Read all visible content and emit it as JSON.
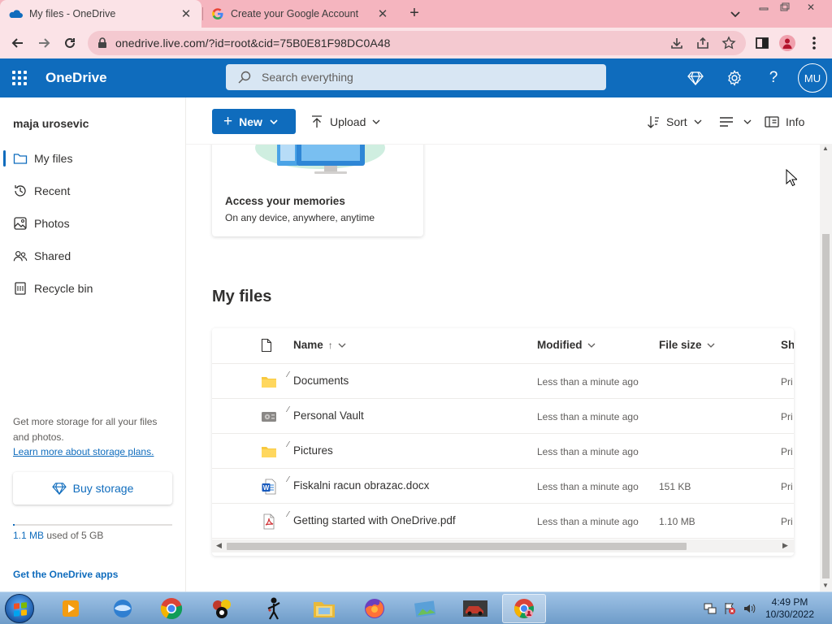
{
  "browser": {
    "tabs": [
      {
        "title": "My files - OneDrive",
        "icon": "onedrive-cloud-icon",
        "active": true
      },
      {
        "title": "Create your Google Account",
        "icon": "google-g-icon",
        "active": false
      }
    ],
    "url": "onedrive.live.com/?id=root&cid=75B0E81F98DC0A48"
  },
  "header": {
    "brand": "OneDrive",
    "search_placeholder": "Search everything",
    "avatar_initials": "MU"
  },
  "nav": {
    "user_name": "maja urosevic",
    "items": [
      {
        "label": "My files",
        "icon": "folder-icon",
        "selected": true
      },
      {
        "label": "Recent",
        "icon": "history-icon",
        "selected": false
      },
      {
        "label": "Photos",
        "icon": "photos-icon",
        "selected": false
      },
      {
        "label": "Shared",
        "icon": "people-icon",
        "selected": false
      },
      {
        "label": "Recycle bin",
        "icon": "recycle-bin-icon",
        "selected": false
      }
    ],
    "storage_text": "Get more storage for all your files and photos.",
    "storage_link": "Learn more about storage plans.",
    "buy_storage": "Buy storage",
    "quota_used": "1.1 MB",
    "quota_rest": " used of 5 GB",
    "quota_fraction": 0.0002,
    "get_apps": "Get the OneDrive apps"
  },
  "commands": {
    "new": "New",
    "upload": "Upload",
    "sort": "Sort",
    "info": "Info"
  },
  "memories": {
    "title": "Access your memories",
    "subtitle": "On any device, anywhere, anytime"
  },
  "files": {
    "section_title": "My files",
    "columns": {
      "name": "Name",
      "name_sort": "↑",
      "modified": "Modified",
      "size": "File size",
      "sharing": "Sh"
    },
    "rows": [
      {
        "name": "Documents",
        "type": "folder",
        "modified": "Less than a minute ago",
        "size": "",
        "sharing": "Pri"
      },
      {
        "name": "Personal Vault",
        "type": "vault",
        "modified": "Less than a minute ago",
        "size": "",
        "sharing": "Pri"
      },
      {
        "name": "Pictures",
        "type": "folder",
        "modified": "Less than a minute ago",
        "size": "",
        "sharing": "Pri"
      },
      {
        "name": "Fiskalni racun obrazac.docx",
        "type": "word",
        "modified": "Less than a minute ago",
        "size": "151 KB",
        "sharing": "Pri"
      },
      {
        "name": "Getting started with OneDrive.pdf",
        "type": "pdf",
        "modified": "Less than a minute ago",
        "size": "1.10 MB",
        "sharing": "Pri"
      }
    ]
  },
  "taskbar": {
    "time": "4:49 PM",
    "date": "10/30/2022"
  },
  "colors": {
    "accent": "#0f6cbd",
    "browser_frame": "#f5b5bf",
    "folder": "#f8c93f"
  }
}
